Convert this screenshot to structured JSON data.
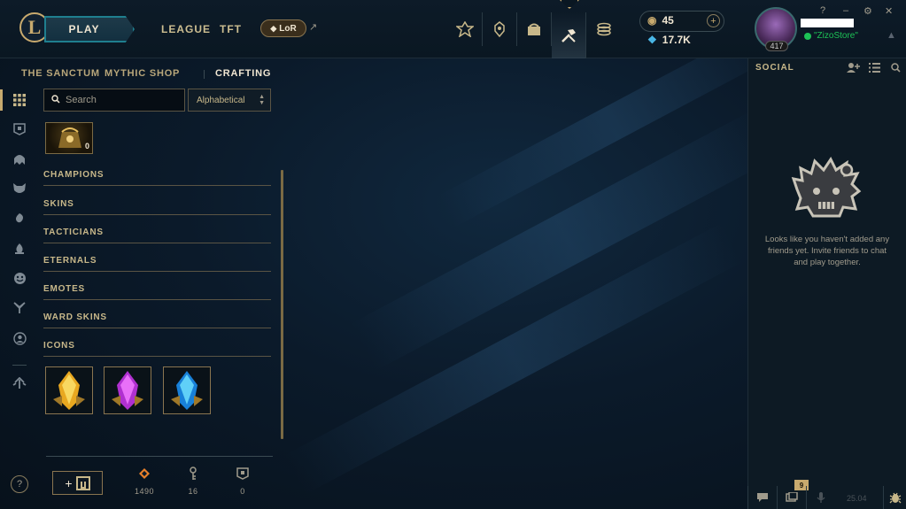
{
  "topbar": {
    "play_label": "PLAY",
    "nav": [
      "LEAGUE",
      "TFT"
    ],
    "lor_label": "LoR",
    "icons": [
      "event-hub-icon",
      "profile-rank-icon",
      "collection-icon",
      "crafting-icon",
      "store-icon"
    ],
    "currency": {
      "rp": "45",
      "blue_essence": "17.7K"
    },
    "profile": {
      "level": "417",
      "status": "\"ZizoStore\""
    },
    "window_controls": [
      "?",
      "–",
      "⚙",
      "✕"
    ]
  },
  "subnav": {
    "items": [
      "THE SANCTUM",
      "MYTHIC SHOP",
      "CRAFTING"
    ],
    "active": "CRAFTING"
  },
  "rail": {
    "icons": [
      "all-items-icon",
      "chest-icon",
      "champion-icon",
      "skin-icon",
      "tactician-icon",
      "eternal-icon",
      "emote-icon",
      "ward-icon",
      "profile-icon",
      "materials-icon"
    ]
  },
  "crafting": {
    "search_placeholder": "Search",
    "sort_value": "Alphabetical",
    "chest_count": "0",
    "categories": [
      "CHAMPIONS",
      "SKINS",
      "TACTICIANS",
      "ETERNALS",
      "EMOTES",
      "WARD SKINS",
      "ICONS"
    ],
    "essence_tiles": [
      "gold-essence-icon",
      "purple-essence-icon",
      "blue-essence-icon"
    ],
    "craft_button_label": "+",
    "resources": [
      {
        "icon": "orange-essence-icon",
        "value": "1490"
      },
      {
        "icon": "key-fragment-icon",
        "value": "16"
      },
      {
        "icon": "chest-count-icon",
        "value": "0"
      }
    ]
  },
  "social": {
    "title": "SOCIAL",
    "empty_message": "Looks like you haven't added any friends yet. Invite friends to chat and play together.",
    "notification_count": "9",
    "version": "25.04"
  },
  "colors": {
    "gold": "#c8aa6e",
    "teal": "#1f7f8f",
    "online": "#1dc256",
    "background": "#0b1a2a"
  }
}
